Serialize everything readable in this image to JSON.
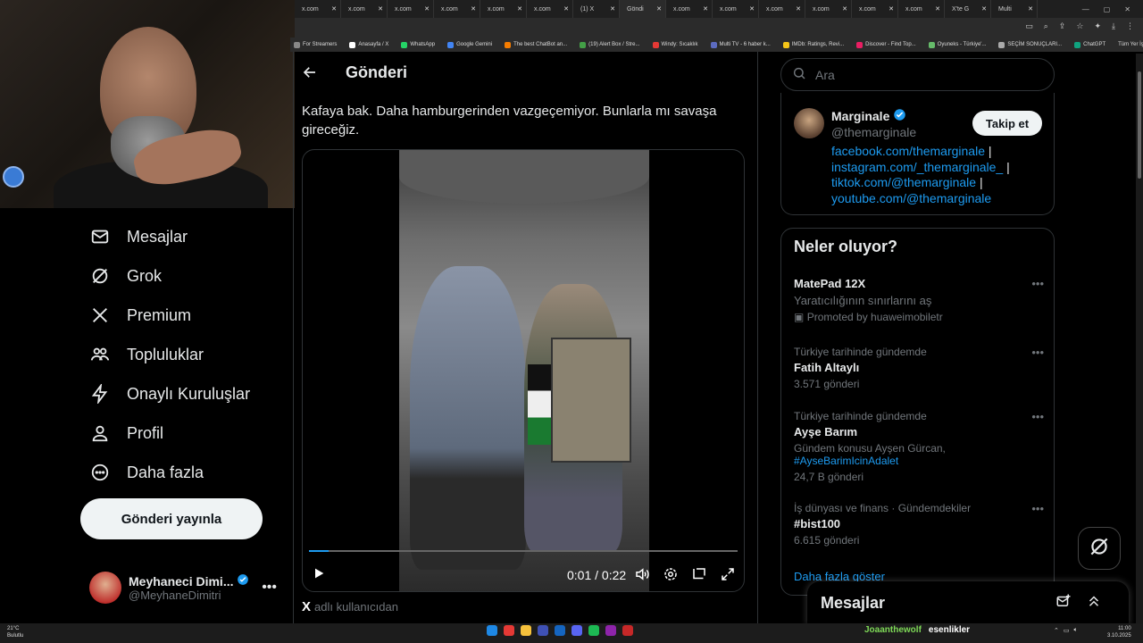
{
  "browser": {
    "tabs": [
      "x.com",
      "x.com",
      "x.com",
      "x.com",
      "x.com",
      "x.com",
      "(1) X",
      "Göndi",
      "x.com",
      "x.com",
      "x.com",
      "x.com",
      "x.com",
      "x.com",
      "X'te G",
      "Multi"
    ],
    "bookmarks": [
      "For Streamers",
      "Anasayfa / X",
      "WhatsApp",
      "Google Gemini",
      "The best ChatBot an...",
      "(19) Alert Box / Stre...",
      "Windy: Sıcaklık",
      "Multi TV - 6 haber k...",
      "IMDb: Ratings, Revi...",
      "Discover - Find Top...",
      "Oyuneks - Türkiye'...",
      "SEÇİM SONUÇLARI...",
      "ChatGPT"
    ],
    "bookmarks_folder": "Tüm Yer İşaretleri"
  },
  "sidebar": {
    "items": [
      {
        "label": "Mesajlar",
        "icon": "mail-icon"
      },
      {
        "label": "Grok",
        "icon": "grok-icon"
      },
      {
        "label": "Premium",
        "icon": "x-logo-icon"
      },
      {
        "label": "Topluluklar",
        "icon": "communities-icon"
      },
      {
        "label": "Onaylı Kuruluşlar",
        "icon": "lightning-icon"
      },
      {
        "label": "Profil",
        "icon": "person-icon"
      },
      {
        "label": "Daha fazla",
        "icon": "more-circle-icon"
      }
    ],
    "post_button": "Gönderi yayınla",
    "account": {
      "name": "Meyhaneci Dimi...",
      "handle": "@MeyhaneDimitri"
    }
  },
  "main": {
    "title": "Gönderi",
    "post_text": "Kafaya bak. Daha hamburgerinden vazgeçemiyor. Bunlarla mı savaşa gireceğiz.",
    "video": {
      "time": "0:01 / 0:22",
      "progress_percent": 4.5
    },
    "source": "adlı kullanıcıdan"
  },
  "right": {
    "search_placeholder": "Ara",
    "profile": {
      "name": "Marginale",
      "handle": "@themarginale",
      "follow": "Takip et",
      "links": [
        "facebook.com/themarginale",
        "instagram.com/_themarginale_",
        "tiktok.com/@themarginale",
        "youtube.com/@themarginale"
      ]
    },
    "trends_title": "Neler oluyor?",
    "trends": [
      {
        "context": "",
        "title": "MatePad 12X",
        "sub": "Yaratıcılığının sınırlarını aş",
        "extra": "Promoted by huaweimobiletr"
      },
      {
        "context": "Türkiye tarihinde gündemde",
        "title": "Fatih Altaylı",
        "sub": "3.571 gönderi",
        "extra": ""
      },
      {
        "context": "Türkiye tarihinde gündemde",
        "title": "Ayşe Barım",
        "sub": "Gündem konusu Ayşen Gürcan,",
        "extra": "#AyseBarimIcinAdalet",
        "posts": "24,7 B gönderi"
      },
      {
        "context": "İş dünyası ve finans · Gündemdekiler",
        "title": "#bist100",
        "sub": "6.615 gönderi",
        "extra": ""
      }
    ],
    "show_more": "Daha fazla göster",
    "messages_drawer": "Mesajlar"
  },
  "taskbar": {
    "weather_temp": "21°C",
    "weather_desc": "Bulutlu",
    "chat_user": "Joaanthewolf",
    "chat_msg": "esenlikler",
    "time": "11:00",
    "date": "3.10.2025"
  },
  "colors": {
    "accent": "#1d9bf0",
    "background": "#000000",
    "border": "#2f3336",
    "muted": "#71767b"
  }
}
